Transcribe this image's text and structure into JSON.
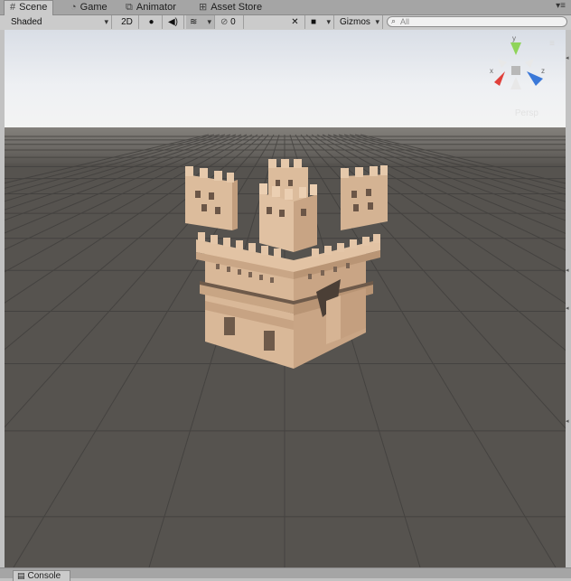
{
  "tabs": [
    {
      "label": "Scene",
      "icon": "hash-icon",
      "active": true
    },
    {
      "label": "Game",
      "icon": "pacman-icon",
      "active": false
    },
    {
      "label": "Animator",
      "icon": "animator-icon",
      "active": false
    },
    {
      "label": "Asset Store",
      "icon": "store-icon",
      "active": false
    }
  ],
  "toolbar": {
    "shading_mode": "Shaded",
    "mode_2d": "2D",
    "fx_count": "0",
    "gizmos": "Gizmos",
    "search_placeholder": "All"
  },
  "viewport": {
    "projection": "Persp",
    "sky_top": "#dfe3ea",
    "horizon": "#8a8783",
    "ground": "#55524f",
    "castle_color": "#d8b596",
    "gizmo_colors": {
      "x": "#e0403a",
      "y": "#8fd45a",
      "z": "#3a78d8"
    }
  },
  "bottom": {
    "console_label": "Console"
  }
}
